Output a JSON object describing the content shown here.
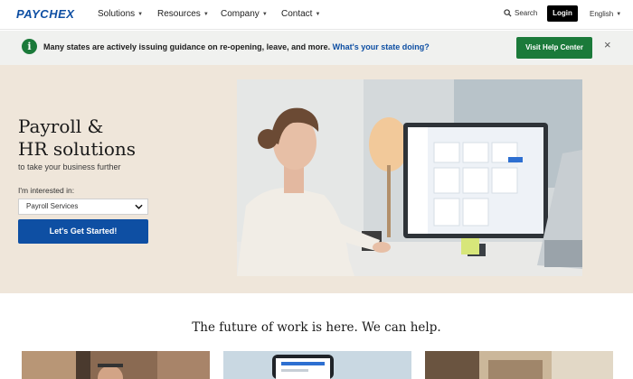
{
  "brand": {
    "logo_text": "PAYCHEX",
    "color": "#0e4fa3"
  },
  "nav": {
    "items": [
      {
        "label": "Solutions"
      },
      {
        "label": "Resources"
      },
      {
        "label": "Company"
      },
      {
        "label": "Contact"
      }
    ],
    "search_label": "Search",
    "login_label": "Login",
    "language_label": "English"
  },
  "alert": {
    "icon": "info-icon",
    "icon_glyph": "i",
    "text": "Many states are actively issuing guidance on re-opening, leave, and more.",
    "link_text": "What's your state doing?",
    "button_label": "Visit Help Center",
    "close_glyph": "×"
  },
  "hero": {
    "title_line1": "Payroll &",
    "title_line2": "HR solutions",
    "subtitle": "to take your business further",
    "interest_label": "I'm interested in:",
    "select_value": "Payroll Services",
    "cta_label": "Let's Get Started!"
  },
  "section": {
    "tagline": "The future of work is here. We can help."
  },
  "colors": {
    "hero_bg": "#efe6da",
    "alert_green": "#1b7a3a",
    "primary_blue": "#0e4fa3"
  }
}
